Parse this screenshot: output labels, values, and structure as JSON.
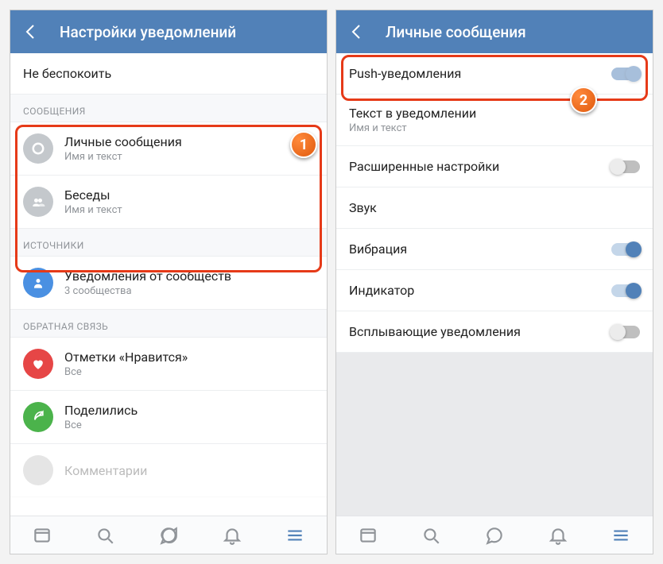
{
  "left": {
    "headerTitle": "Настройки уведомлений",
    "doNotDisturb": "Не беспокоить",
    "sectionMessages": "СООБЩЕНИЯ",
    "items": {
      "pm": {
        "title": "Личные сообщения",
        "sub": "Имя и текст"
      },
      "chats": {
        "title": "Беседы",
        "sub": "Имя и текст"
      }
    },
    "sectionSources": "ИСТОЧНИКИ",
    "communities": {
      "title": "Уведомления от сообществ",
      "sub": "3 сообщества"
    },
    "sectionFeedback": "ОБРАТНАЯ СВЯЗЬ",
    "likes": {
      "title": "Отметки «Нравится»",
      "sub": "Все"
    },
    "shares": {
      "title": "Поделились",
      "sub": "Все"
    },
    "comments": {
      "title": "Комментарии"
    }
  },
  "right": {
    "headerTitle": "Личные сообщения",
    "push": "Push-уведомления",
    "textInNotif": {
      "title": "Текст в уведомлении",
      "sub": "Имя и текст"
    },
    "advanced": "Расширенные настройки",
    "sound": "Звук",
    "vibration": "Вибрация",
    "indicator": "Индикатор",
    "popup": "Всплывающие уведомления"
  },
  "callouts": {
    "one": "1",
    "two": "2"
  }
}
